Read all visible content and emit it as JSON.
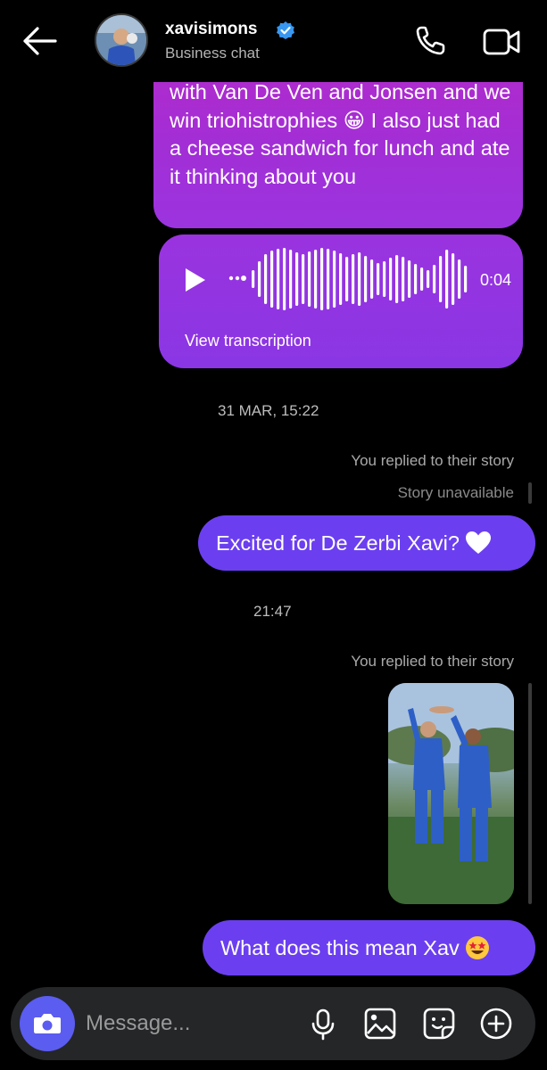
{
  "header": {
    "username": "xavisimons",
    "subtitle": "Business chat",
    "icons": [
      "back-arrow-icon",
      "verified-badge-icon",
      "phone-icon",
      "video-camera-icon"
    ]
  },
  "messages": {
    "text_message": "with Van De Ven and Jonsen and we win triohistrophies 😀 I also just had a cheese sandwich for lunch and ate it thinking about you",
    "voice_duration": "0:04",
    "view_transcription": "View transcription",
    "timestamp_1": "31 MAR, 15:22",
    "reply_label_1": "You replied to their story",
    "story_unavailable": "Story unavailable",
    "reply_message_1": "Excited for De Zerbi Xavi?",
    "timestamp_2": "21:47",
    "reply_label_2": "You replied to their story",
    "reply_message_2": "What does this mean Xav"
  },
  "composer": {
    "placeholder": "Message...",
    "icons": [
      "camera-icon",
      "microphone-icon",
      "gallery-icon",
      "sticker-icon",
      "plus-icon"
    ]
  },
  "colors": {
    "background": "#000000",
    "bubble_magenta": "#b12bcb",
    "bubble_violet": "#6b3ff0",
    "verified_blue": "#3897f0",
    "composer_bg": "#242628"
  }
}
